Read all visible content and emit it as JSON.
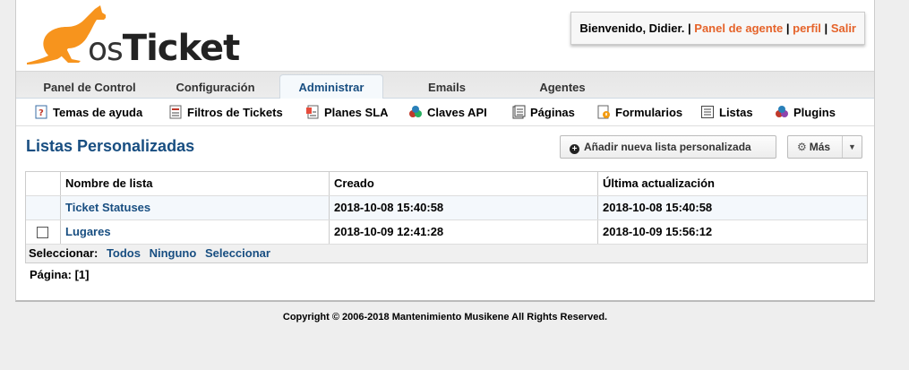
{
  "header": {
    "logo_text_os": "os",
    "logo_text_ticket": "Ticket",
    "welcome": "Bienvenido, Didier.",
    "separator": " | ",
    "links": [
      "Panel de agente",
      "perfil",
      "Salir"
    ]
  },
  "nav": {
    "tabs": [
      {
        "label": "Panel de Control",
        "active": false
      },
      {
        "label": "Configuración",
        "active": false
      },
      {
        "label": "Administrar",
        "active": true
      },
      {
        "label": "Emails",
        "active": false
      },
      {
        "label": "Agentes",
        "active": false
      }
    ]
  },
  "subnav": {
    "items": [
      {
        "label": "Temas de ayuda",
        "icon": "help-topics-icon"
      },
      {
        "label": "Filtros de Tickets",
        "icon": "filters-icon"
      },
      {
        "label": "Planes SLA",
        "icon": "sla-icon"
      },
      {
        "label": "Claves API",
        "icon": "api-keys-icon"
      },
      {
        "label": "Páginas",
        "icon": "pages-icon"
      },
      {
        "label": "Formularios",
        "icon": "forms-icon"
      },
      {
        "label": "Listas",
        "icon": "lists-icon"
      },
      {
        "label": "Plugins",
        "icon": "plugins-icon"
      }
    ]
  },
  "main": {
    "title": "Listas Personalizadas",
    "add_button": "Añadir nueva lista personalizada",
    "more_button": "Más"
  },
  "table": {
    "columns": [
      "Nombre de lista",
      "Creado",
      "Última actualización"
    ],
    "rows": [
      {
        "name": "Ticket Statuses",
        "created": "2018-10-08 15:40:58",
        "updated": "2018-10-08 15:40:58",
        "checkbox": false
      },
      {
        "name": "Lugares",
        "created": "2018-10-09 12:41:28",
        "updated": "2018-10-09 15:56:12",
        "checkbox": true
      }
    ],
    "select_label": "Seleccionar:",
    "select_links": [
      "Todos",
      "Ninguno",
      "Seleccionar"
    ]
  },
  "pagination": {
    "label": "Página:",
    "current": "[1]"
  },
  "footer": {
    "copyright": "Copyright © 2006-2018 Mantenimiento Musikene All Rights Reserved."
  },
  "colors": {
    "accent_link": "#e5632a",
    "brand_blue": "#184e81",
    "logo_orange": "#f7941d"
  }
}
